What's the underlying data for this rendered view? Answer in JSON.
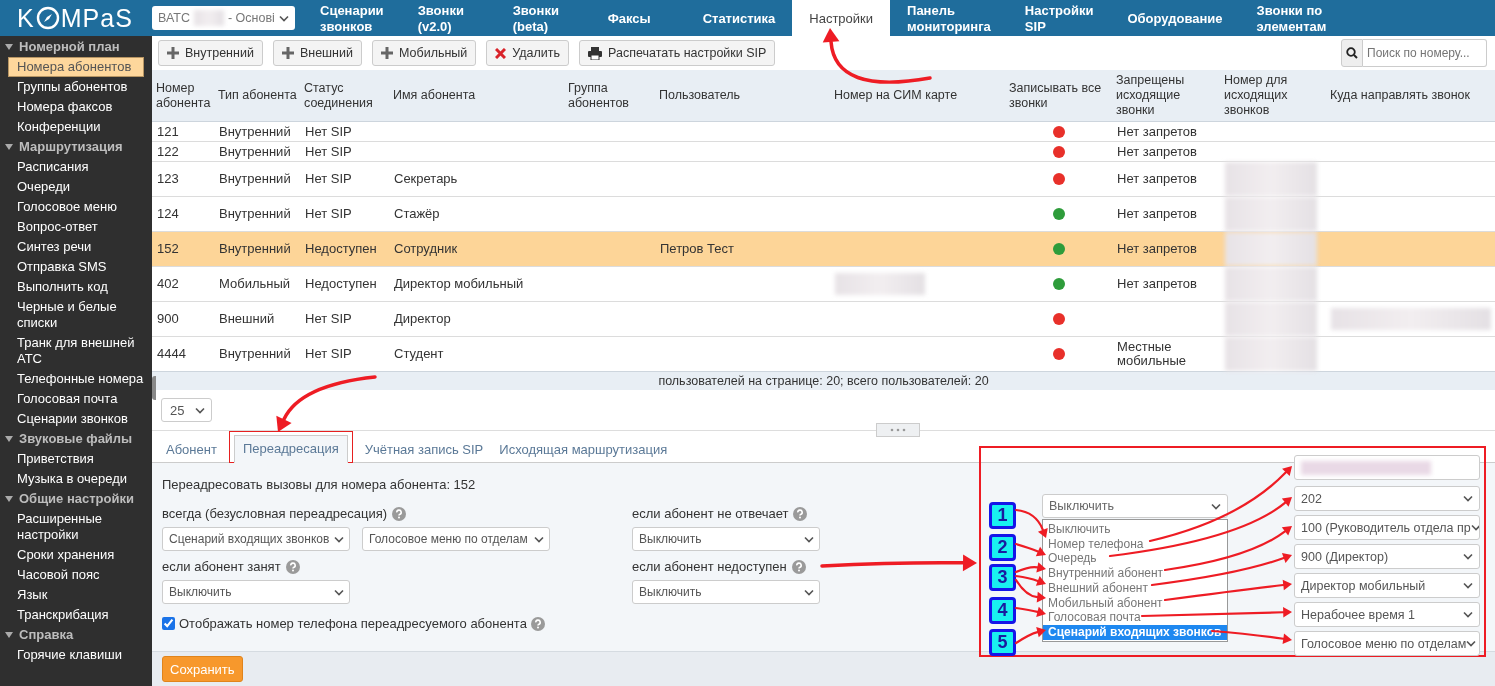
{
  "logo": {
    "lead": "K",
    "tail": "MPaS"
  },
  "pbx_select": {
    "prefix": "ВАТС",
    "value": "- Основі"
  },
  "nav": [
    {
      "lines": [
        "Сценарии",
        "звонков"
      ],
      "selected": false
    },
    {
      "lines": [
        "Звонки",
        "(v2.0)"
      ],
      "selected": false
    },
    {
      "lines": [
        "Звонки",
        "(beta)"
      ],
      "selected": false
    },
    {
      "lines": [
        "Факсы"
      ],
      "selected": false
    },
    {
      "lines": [
        "Статистика"
      ],
      "selected": false
    },
    {
      "lines": [
        "Настройки"
      ],
      "selected": true
    },
    {
      "lines": [
        "Панель",
        "мониторинга"
      ],
      "selected": false
    },
    {
      "lines": [
        "Настройки",
        "SIP"
      ],
      "selected": false
    },
    {
      "lines": [
        "Оборудование"
      ],
      "selected": false
    },
    {
      "lines": [
        "Звонки по",
        "элементам"
      ],
      "selected": false
    }
  ],
  "sidebar": [
    {
      "label": "Номерной план",
      "expanded": true,
      "children": [
        {
          "label": "Номера абонентов",
          "selected": true
        },
        {
          "label": "Группы абонентов",
          "selected": false
        },
        {
          "label": "Номера факсов",
          "selected": false
        },
        {
          "label": "Конференции",
          "selected": false
        }
      ]
    },
    {
      "label": "Маршрутизация",
      "expanded": true,
      "children": [
        {
          "label": "Расписания",
          "selected": false
        },
        {
          "label": "Очереди",
          "selected": false
        },
        {
          "label": "Голосовое меню",
          "selected": false
        },
        {
          "label": "Вопрос-ответ",
          "selected": false
        },
        {
          "label": "Синтез речи",
          "selected": false
        },
        {
          "label": "Отправка SMS",
          "selected": false
        },
        {
          "label": "Выполнить код",
          "selected": false
        },
        {
          "label": "Черные и белые списки",
          "selected": false
        },
        {
          "label": "Транк для внешней АТС",
          "selected": false
        },
        {
          "label": "Телефонные номера",
          "selected": false
        },
        {
          "label": "Голосовая почта",
          "selected": false
        },
        {
          "label": "Сценарии звонков",
          "selected": false
        }
      ]
    },
    {
      "label": "Звуковые файлы",
      "expanded": true,
      "children": [
        {
          "label": "Приветствия",
          "selected": false
        },
        {
          "label": "Музыка в очереди",
          "selected": false
        }
      ]
    },
    {
      "label": "Общие настройки",
      "expanded": true,
      "children": [
        {
          "label": "Расширенные настройки",
          "selected": false
        },
        {
          "label": "Сроки хранения",
          "selected": false
        },
        {
          "label": "Часовой пояс",
          "selected": false
        },
        {
          "label": "Язык",
          "selected": false
        },
        {
          "label": "Транскрибация",
          "selected": false
        }
      ]
    },
    {
      "label": "Справка",
      "expanded": true,
      "children": [
        {
          "label": "Горячие клавиши",
          "selected": false
        }
      ]
    }
  ],
  "toolbar": [
    {
      "kind": "add",
      "label": "Внутренний"
    },
    {
      "kind": "add",
      "label": "Внешний"
    },
    {
      "kind": "add",
      "label": "Мобильный"
    },
    {
      "kind": "delete",
      "label": "Удалить"
    },
    {
      "kind": "print",
      "label": "Распечатать настройки SIP"
    }
  ],
  "search": {
    "placeholder": "Поиск по номеру..."
  },
  "table": {
    "columns": [
      "Номер абонента",
      "Тип абонента",
      "Статус соединения",
      "Имя абонента",
      "Группа абонентов",
      "Пользователь",
      "Номер на СИМ карте",
      "Записывать все звонки",
      "Запрещены исходящие звонки",
      "Номер для исходящих звонков",
      "Куда направлять звонок"
    ],
    "rows": [
      {
        "number": "121",
        "type": "Внутренний",
        "status": "Нет SIP",
        "sim_redacted": false,
        "record_all": false,
        "forbidden": "Нет запретов",
        "outgoing_redacted": false,
        "forward_redacted": false,
        "selected": false
      },
      {
        "number": "122",
        "type": "Внутренний",
        "status": "Нет SIP",
        "sim_redacted": false,
        "record_all": false,
        "forbidden": "Нет запретов",
        "outgoing_redacted": false,
        "forward_redacted": false,
        "selected": false
      },
      {
        "number": "123",
        "type": "Внутренний",
        "status": "Нет SIP",
        "name": "Секретарь",
        "sim_redacted": false,
        "record_all": false,
        "forbidden": "Нет запретов",
        "outgoing_redacted": true,
        "forward_redacted": false,
        "selected": false
      },
      {
        "number": "124",
        "type": "Внутренний",
        "status": "Нет SIP",
        "name": "Стажёр",
        "sim_redacted": false,
        "record_all": true,
        "forbidden": "Нет запретов",
        "outgoing_redacted": true,
        "forward_redacted": false,
        "selected": false
      },
      {
        "number": "152",
        "type": "Внутренний",
        "status": "Недоступен",
        "name": "Сотрудник",
        "user": "Петров Тест",
        "sim_redacted": false,
        "record_all": true,
        "forbidden": "Нет запретов",
        "outgoing_redacted": true,
        "forward_redacted": false,
        "selected": true
      },
      {
        "number": "402",
        "type": "Мобильный",
        "status": "Недоступен",
        "name": "Директор мобильный",
        "sim_redacted": true,
        "record_all": true,
        "forbidden": "Нет запретов",
        "outgoing_redacted": true,
        "forward_redacted": false,
        "selected": false
      },
      {
        "number": "900",
        "type": "Внешний",
        "status": "Нет SIP",
        "name": "Директор",
        "sim_redacted": false,
        "record_all": false,
        "outgoing_redacted": true,
        "forward_redacted": true,
        "selected": false
      },
      {
        "number": "4444",
        "type": "Внутренний",
        "status": "Нет SIP",
        "name": "Студент",
        "sim_redacted": false,
        "record_all": false,
        "forbidden": "Местные мобильные",
        "outgoing_redacted": true,
        "forward_redacted": false,
        "selected": false
      }
    ],
    "footer": "пользователей на странице: 20; всего пользователей: 20"
  },
  "page_size": "25",
  "detail_tabs": [
    {
      "label": "Абонент",
      "selected": false,
      "highlighted": false
    },
    {
      "label": "Переадресация",
      "selected": true,
      "highlighted": true
    },
    {
      "label": "Учётная запись SIP",
      "selected": false,
      "highlighted": false
    },
    {
      "label": "Исходящая маршрутизация",
      "selected": false,
      "highlighted": false
    }
  ],
  "forwarding": {
    "heading": "Переадресовать вызовы для номера абонента: 152",
    "rules": [
      {
        "label": "всегда (безусловная переадресация)",
        "selects": [
          "Сценарий входящих звонков",
          "Голосовое меню по отделам"
        ]
      },
      {
        "label": "если абонент не отвечает",
        "selects": [
          "Выключить"
        ]
      },
      {
        "label": "если абонент занят",
        "selects": [
          "Выключить"
        ]
      },
      {
        "label": "если абонент недоступен",
        "selects": [
          "Выключить"
        ]
      }
    ],
    "show_number": {
      "label": "Отображать номер телефона переадресуемого абонента",
      "checked": true
    }
  },
  "save_button": "Сохранить",
  "callout": {
    "select_value": "Выключить",
    "options": [
      {
        "label": "Выключить",
        "selected": false
      },
      {
        "label": "Номер телефона",
        "selected": false
      },
      {
        "label": "Очередь",
        "selected": false
      },
      {
        "label": "Внутренний абонент",
        "selected": false
      },
      {
        "label": "Внешний абонент",
        "selected": false
      },
      {
        "label": "Мобильный абонент",
        "selected": false
      },
      {
        "label": "Голосовая почта",
        "selected": false
      },
      {
        "label": "Сценарий входящих звонков",
        "selected": true
      }
    ],
    "badges": [
      "1",
      "2",
      "3",
      "4",
      "5"
    ],
    "targets": [
      {
        "kind": "redacted"
      },
      {
        "kind": "select",
        "value": "202"
      },
      {
        "kind": "select",
        "value": "100 (Руководитель отдела пр"
      },
      {
        "kind": "select",
        "value": "900 (Директор)"
      },
      {
        "kind": "select",
        "value": "Директор мобильный"
      },
      {
        "kind": "select",
        "value": "Нерабочее время 1"
      },
      {
        "kind": "select",
        "value": "Голосовое меню по отделам"
      }
    ]
  }
}
